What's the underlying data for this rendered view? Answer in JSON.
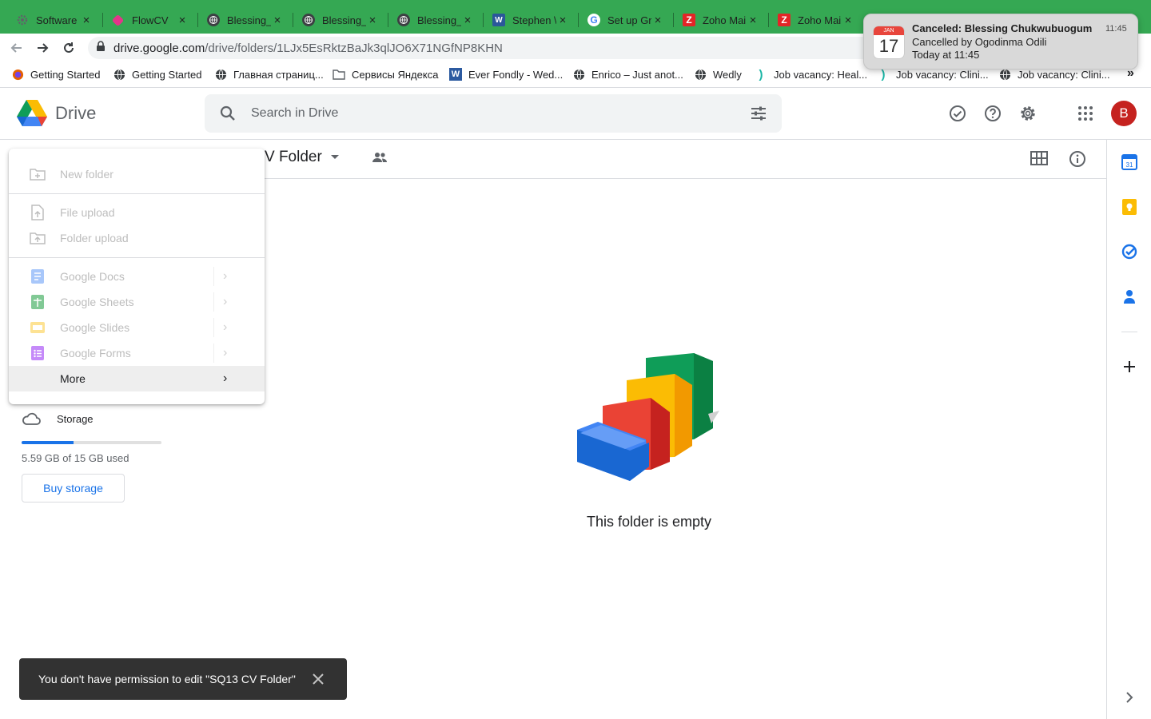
{
  "browser": {
    "tabs": [
      {
        "title": "Software",
        "icon": "gear-icon"
      },
      {
        "title": "FlowCV",
        "icon": "flowcv-icon"
      },
      {
        "title": "Blessing_",
        "icon": "globe-icon"
      },
      {
        "title": "Blessing_",
        "icon": "globe-icon"
      },
      {
        "title": "Blessing_",
        "icon": "globe-icon"
      },
      {
        "title": "Stephen \\",
        "icon": "word-icon"
      },
      {
        "title": "Set up Gr",
        "icon": "google-icon"
      },
      {
        "title": "Zoho Mai",
        "icon": "zoho-icon"
      },
      {
        "title": "Zoho Mai",
        "icon": "zoho-icon"
      }
    ],
    "address": {
      "host": "drive.google.com",
      "path": "/drive/folders/1LJx5EsRktzBaJk3qlJO6X71NGfNP8KHN"
    },
    "bookmarks": [
      {
        "label": "Getting Started",
        "icon": "firefox-icon"
      },
      {
        "label": "Getting Started",
        "icon": "globe-icon"
      },
      {
        "label": "Главная страниц...",
        "icon": "globe-icon"
      },
      {
        "label": "Сервисы Яндекса",
        "icon": "folder-icon"
      },
      {
        "label": "Ever Fondly - Wed...",
        "icon": "wordpress-icon"
      },
      {
        "label": "Enrico – Just anot...",
        "icon": "globe-icon"
      },
      {
        "label": "Wedly",
        "icon": "globe-icon"
      },
      {
        "label": "Job vacancy: Heal...",
        "icon": "paren-icon"
      },
      {
        "label": "Job vacancy: Clini...",
        "icon": "paren-icon"
      },
      {
        "label": "Job vacancy: Clini...",
        "icon": "globe-icon"
      }
    ],
    "more_bookmarks": "»"
  },
  "drive": {
    "logo_text": "Drive",
    "search_placeholder": "Search in Drive",
    "avatar_letter": "B",
    "breadcrumb": "V Folder",
    "empty_text": "This folder is empty",
    "storage": {
      "label": "Storage",
      "used_text": "5.59 GB of 15 GB used",
      "used_fraction": 0.373,
      "buy_label": "Buy storage"
    }
  },
  "new_menu": {
    "items": [
      {
        "label": "New folder",
        "icon": "new-folder-icon"
      },
      {
        "label": "File upload",
        "icon": "file-upload-icon"
      },
      {
        "label": "Folder upload",
        "icon": "folder-upload-icon"
      },
      {
        "label": "Google Docs",
        "icon": "docs-icon"
      },
      {
        "label": "Google Sheets",
        "icon": "sheets-icon"
      },
      {
        "label": "Google Slides",
        "icon": "slides-icon"
      },
      {
        "label": "Google Forms",
        "icon": "forms-icon"
      },
      {
        "label": "More",
        "icon": ""
      }
    ]
  },
  "snackbar": {
    "message": "You don't have permission to edit \"SQ13 CV Folder\""
  },
  "notification": {
    "title": "Canceled: Blessing Chukwubuogum",
    "line2": "Cancelled by Ogodinma Odili",
    "line3": "Today at 11:45",
    "time": "11:45",
    "cal_month": "JAN",
    "cal_day": "17"
  },
  "colors": {
    "tab_strip": "#35a853",
    "accent": "#1a73e8",
    "avatar": "#c5221f",
    "snackbar": "#323232"
  }
}
